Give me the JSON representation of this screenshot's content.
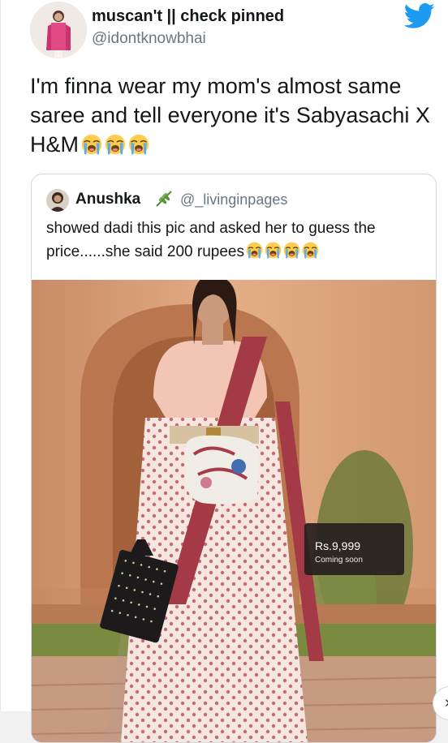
{
  "tweet": {
    "author_name": "muscan't || check pinned",
    "author_handle": "@idontknowbhai",
    "text": "I'm finna wear my mom's almost same saree and tell everyone it's Sabyasachi X H&M",
    "emoji_icons": [
      "loudly-crying-face-icon",
      "loudly-crying-face-icon",
      "loudly-crying-face-icon"
    ]
  },
  "quoted_tweet": {
    "author_name": "Anushka",
    "author_badge_icon": "herb-icon",
    "author_handle": "@_livinginpages",
    "text": "showed dadi this pic and asked her to guess the price......she said 200 rupees",
    "emoji_icons": [
      "loudly-crying-face-icon",
      "loudly-crying-face-icon",
      "loudly-crying-face-icon",
      "loudly-crying-face-icon"
    ],
    "image": {
      "price": "Rs.9,999",
      "status": "Coming soon"
    }
  },
  "colors": {
    "twitter_blue": "#1d9bf0",
    "text": "#14171a",
    "secondary_text": "#657786",
    "border": "#cfd9de"
  }
}
